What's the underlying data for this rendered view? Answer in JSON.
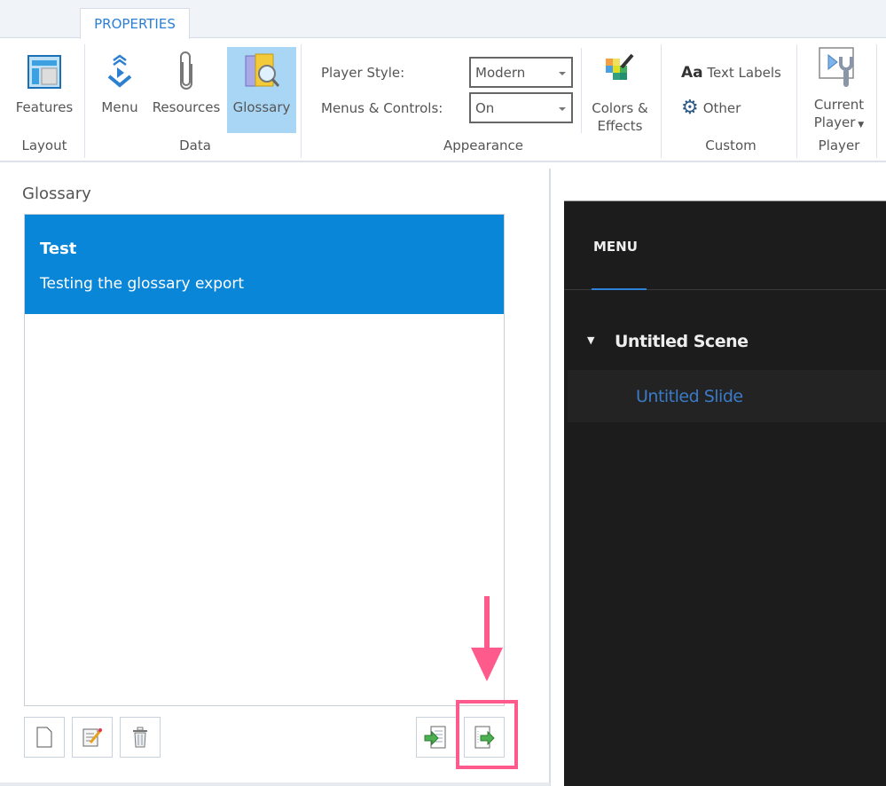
{
  "ribbon": {
    "tab": "PROPERTIES",
    "features": "Features",
    "layout_group": "Layout",
    "menu": "Menu",
    "resources": "Resources",
    "glossary": "Glossary",
    "data_group": "Data",
    "player_style_label": "Player Style:",
    "player_style_value": "Modern",
    "menus_controls_label": "Menus & Controls:",
    "menus_controls_value": "On",
    "colors_effects_1": "Colors &",
    "colors_effects_2": "Effects",
    "appearance_group": "Appearance",
    "text_labels": "Text Labels",
    "text_labels_glyph": "Aa",
    "other": "Other",
    "custom_group": "Custom",
    "current_player_1": "Current",
    "current_player_2": "Player",
    "player_group": "Player"
  },
  "glossary": {
    "title": "Glossary",
    "items": [
      {
        "term": "Test",
        "definition": "Testing the glossary export"
      }
    ]
  },
  "preview": {
    "menu_tab": "MENU",
    "scene": "Untitled Scene",
    "slide": "Untitled Slide"
  },
  "colors": {
    "accent": "#0a86d8",
    "highlight": "#ff5a8c",
    "slide_link": "#3a7bc8"
  }
}
